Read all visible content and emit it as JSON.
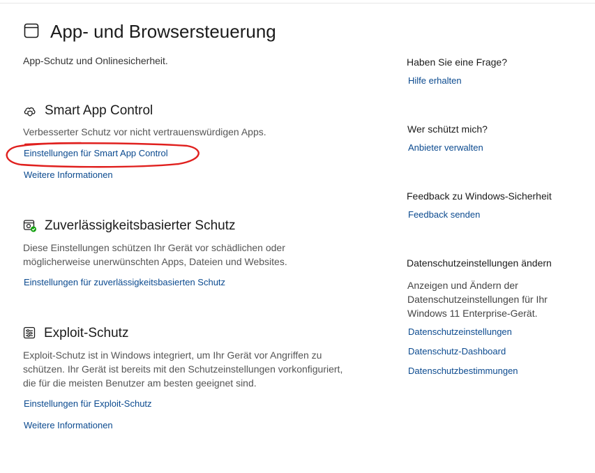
{
  "header": {
    "title": "App- und Browsersteuerung",
    "subtitle": "App-Schutz und Onlinesicherheit.",
    "icon": "browser-window-icon"
  },
  "sections": [
    {
      "title": "Smart App Control",
      "icon": "cloud-shield-icon",
      "description": "Verbesserter Schutz vor nicht vertrauenswürdigen Apps.",
      "links": [
        "Einstellungen für Smart App Control",
        "Weitere Informationen"
      ]
    },
    {
      "title": "Zuverlässigkeitsbasierter Schutz",
      "icon": "reputation-check-icon",
      "description_lines": [
        "Diese Einstellungen schützen Ihr Gerät vor schädlichen oder",
        "möglicherweise unerwünschten Apps, Dateien und Websites."
      ],
      "links": [
        "Einstellungen für zuverlässigkeitsbasierten Schutz"
      ]
    },
    {
      "title": "Exploit-Schutz",
      "icon": "exploit-settings-icon",
      "description_lines": [
        "Exploit-Schutz ist in Windows integriert, um Ihr Gerät vor Angriffen zu",
        "schützen. Ihr Gerät ist bereits mit den Schutzeinstellungen vorkonfiguriert,",
        "die für die meisten Benutzer am besten geeignet sind."
      ],
      "links": [
        "Einstellungen für Exploit-Schutz",
        "Weitere Informationen"
      ]
    }
  ],
  "sidebar": {
    "help": {
      "heading": "Haben Sie eine Frage?",
      "link": "Hilfe erhalten"
    },
    "provider": {
      "heading": "Wer schützt mich?",
      "link": "Anbieter verwalten"
    },
    "feedback": {
      "heading": "Feedback zu Windows-Sicherheit",
      "link": "Feedback senden"
    },
    "privacy": {
      "heading": "Datenschutzeinstellungen ändern",
      "text_lines": [
        "Anzeigen und Ändern der",
        "Datenschutzeinstellungen für Ihr",
        "Windows 11 Enterprise-Gerät."
      ],
      "links": [
        "Datenschutzeinstellungen",
        "Datenschutz-Dashboard",
        "Datenschutzbestimmungen"
      ]
    }
  },
  "annotation": {
    "color": "#e0201e"
  }
}
